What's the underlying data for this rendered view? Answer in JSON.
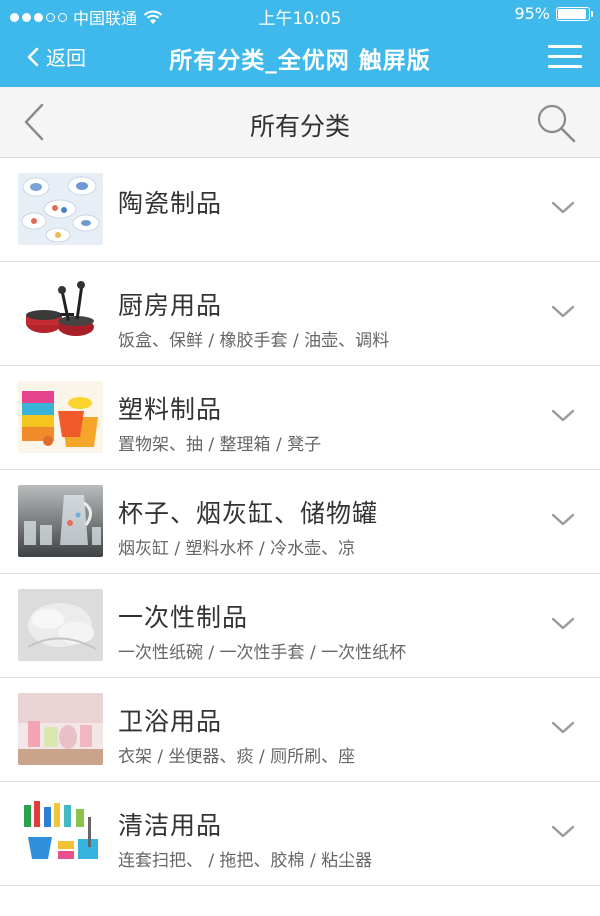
{
  "status_bar": {
    "carrier": "中国联通",
    "time": "上午10:05",
    "battery_text": "95%",
    "battery_level": 0.95
  },
  "nav": {
    "back_label": "返回",
    "title": "所有分类_全优网 触屏版"
  },
  "page": {
    "title": "所有分类"
  },
  "categories": [
    {
      "name": "陶瓷制品",
      "sub": ""
    },
    {
      "name": "厨房用品",
      "sub": "饭盒、保鲜 / 橡胶手套 / 油壶、调料"
    },
    {
      "name": "塑料制品",
      "sub": "置物架、抽 / 整理箱 / 凳子"
    },
    {
      "name": "杯子、烟灰缸、储物罐",
      "sub": "烟灰缸 / 塑料水杯 / 冷水壶、凉"
    },
    {
      "name": "一次性制品",
      "sub": "一次性纸碗 / 一次性手套 / 一次性纸杯"
    },
    {
      "name": "卫浴用品",
      "sub": "衣架 / 坐便器、痰 / 厕所刷、座"
    },
    {
      "name": "清洁用品",
      "sub": "连套扫把、 / 拖把、胶棉 / 粘尘器"
    }
  ],
  "colors": {
    "nav_bg": "#3fb8eb",
    "page_bg": "#f0f0f0"
  }
}
